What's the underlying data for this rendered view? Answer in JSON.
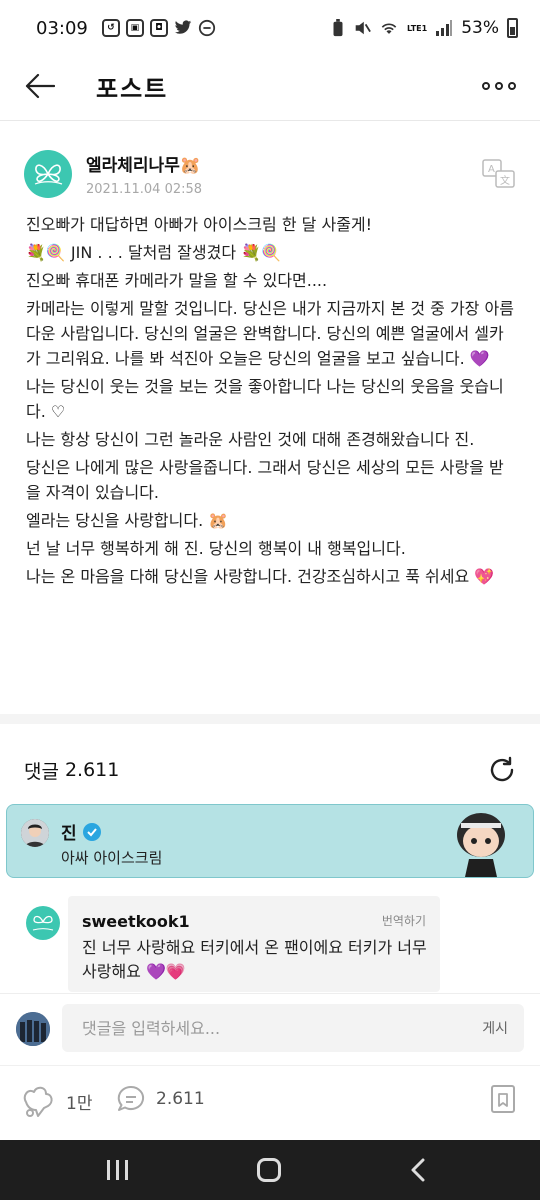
{
  "status_bar": {
    "time": "03:09",
    "battery": "53%",
    "network": "LTE1"
  },
  "header": {
    "title": "포스트"
  },
  "post": {
    "author": "엘라체리나무🐹",
    "date": "2021.11.04 02:58",
    "lines": [
      "진오빠가 대답하면 아빠가 아이스크림 한 달 사줄게!",
      "💐🍭 JIN . . . 달처럼 잘생겼다 💐🍭",
      "진오빠 휴대폰 카메라가 말을 할 수 있다면....",
      "카메라는 이렇게 말할 것입니다. 당신은 내가 지금까지 본 것 중 가장 아름다운 사람입니다. 당신의 얼굴은 완벽합니다. 당신의 예쁜 얼굴에서 셀카가 그리워요. 나를 봐 석진아 오늘은 당신의 얼굴을 보고 싶습니다. 💜",
      "나는 당신이 웃는 것을 보는 것을 좋아합니다 나는 당신의 웃음을 웃습니다. ♡",
      "나는 항상 당신이 그런 놀라운 사람인 것에 대해 존경해왔습니다 진.",
      "당신은 나에게 많은 사랑을줍니다. 그래서 당신은 세상의 모든 사랑을 받을 자격이 있습니다.",
      "엘라는 당신을 사랑합니다. 🐹",
      "넌 날 너무 행복하게 해 진. 당신의 행복이 내 행복입니다.",
      "나는 온 마음을 다해 당신을 사랑합니다. 건강조심하시고 푹 쉬세요 💖"
    ]
  },
  "comments": {
    "label": "댓글",
    "count": "2.611",
    "artist_comment": {
      "name": "진",
      "text": "아싸 아이스크림"
    },
    "fan_comment": {
      "name": "sweetkook1",
      "translate": "번역하기",
      "text": "진 너무 사랑해요 터키에서 온 팬이에요 터키가 너무 사랑해요 💜💗"
    }
  },
  "input": {
    "placeholder": "댓글을 입력하세요...",
    "submit": "게시"
  },
  "actions": {
    "likes": "1만",
    "comments": "2.611"
  },
  "colors": {
    "brand_teal": "#3cc7b1",
    "artist_bg": "#b5e2e4",
    "verified": "#2aa6e0"
  }
}
